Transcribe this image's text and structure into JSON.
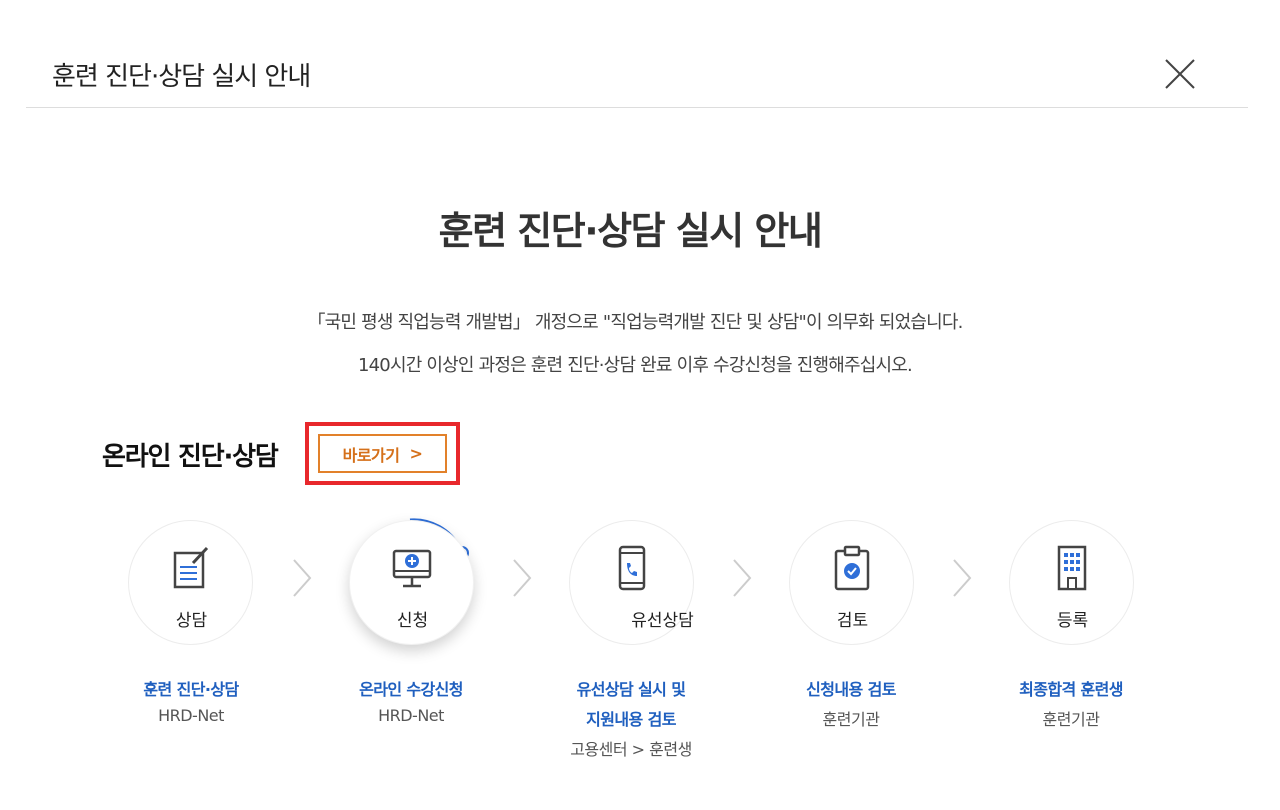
{
  "header": {
    "title": "훈련 진단·상담 실시 안내"
  },
  "main": {
    "title": "훈련 진단·상담 실시 안내",
    "desc_line1": "「국민 평생 직업능력 개발법」 개정으로 \"직업능력개발 진단 및 상담\"이 의무화 되었습니다.",
    "desc_line2": "140시간 이상인 과정은 훈련 진단·상담 완료 이후 수강신청을 진행해주십시오."
  },
  "online": {
    "label": "온라인 진단·상담",
    "go_button": "바로가기",
    "go_arrow": ">"
  },
  "steps": [
    {
      "label": "상담",
      "icon": "document-pen-icon",
      "caption_title": "훈련 진단·상담",
      "caption_sub": "HRD-Net"
    },
    {
      "label": "신청",
      "icon": "monitor-plus-icon",
      "caption_title": "온라인 수강신청",
      "caption_sub": "HRD-Net",
      "active": true
    },
    {
      "label": "유선상담",
      "icon": "phone-icon",
      "caption_title_1": "유선상담 실시 및",
      "caption_title_2": "지원내용 검토",
      "caption_sub": "고용센터 > 훈련생"
    },
    {
      "label": "검토",
      "icon": "clipboard-check-icon",
      "caption_title": "신청내용 검토",
      "caption_sub": "훈련기관"
    },
    {
      "label": "등록",
      "icon": "building-icon",
      "caption_title": "최종합격 훈련생",
      "caption_sub": "훈련기관"
    }
  ],
  "colors": {
    "accent_blue": "#1f5fbf",
    "button_orange": "#e2812a",
    "highlight_red": "#e8282c",
    "icon_blue": "#2f6fd8"
  }
}
